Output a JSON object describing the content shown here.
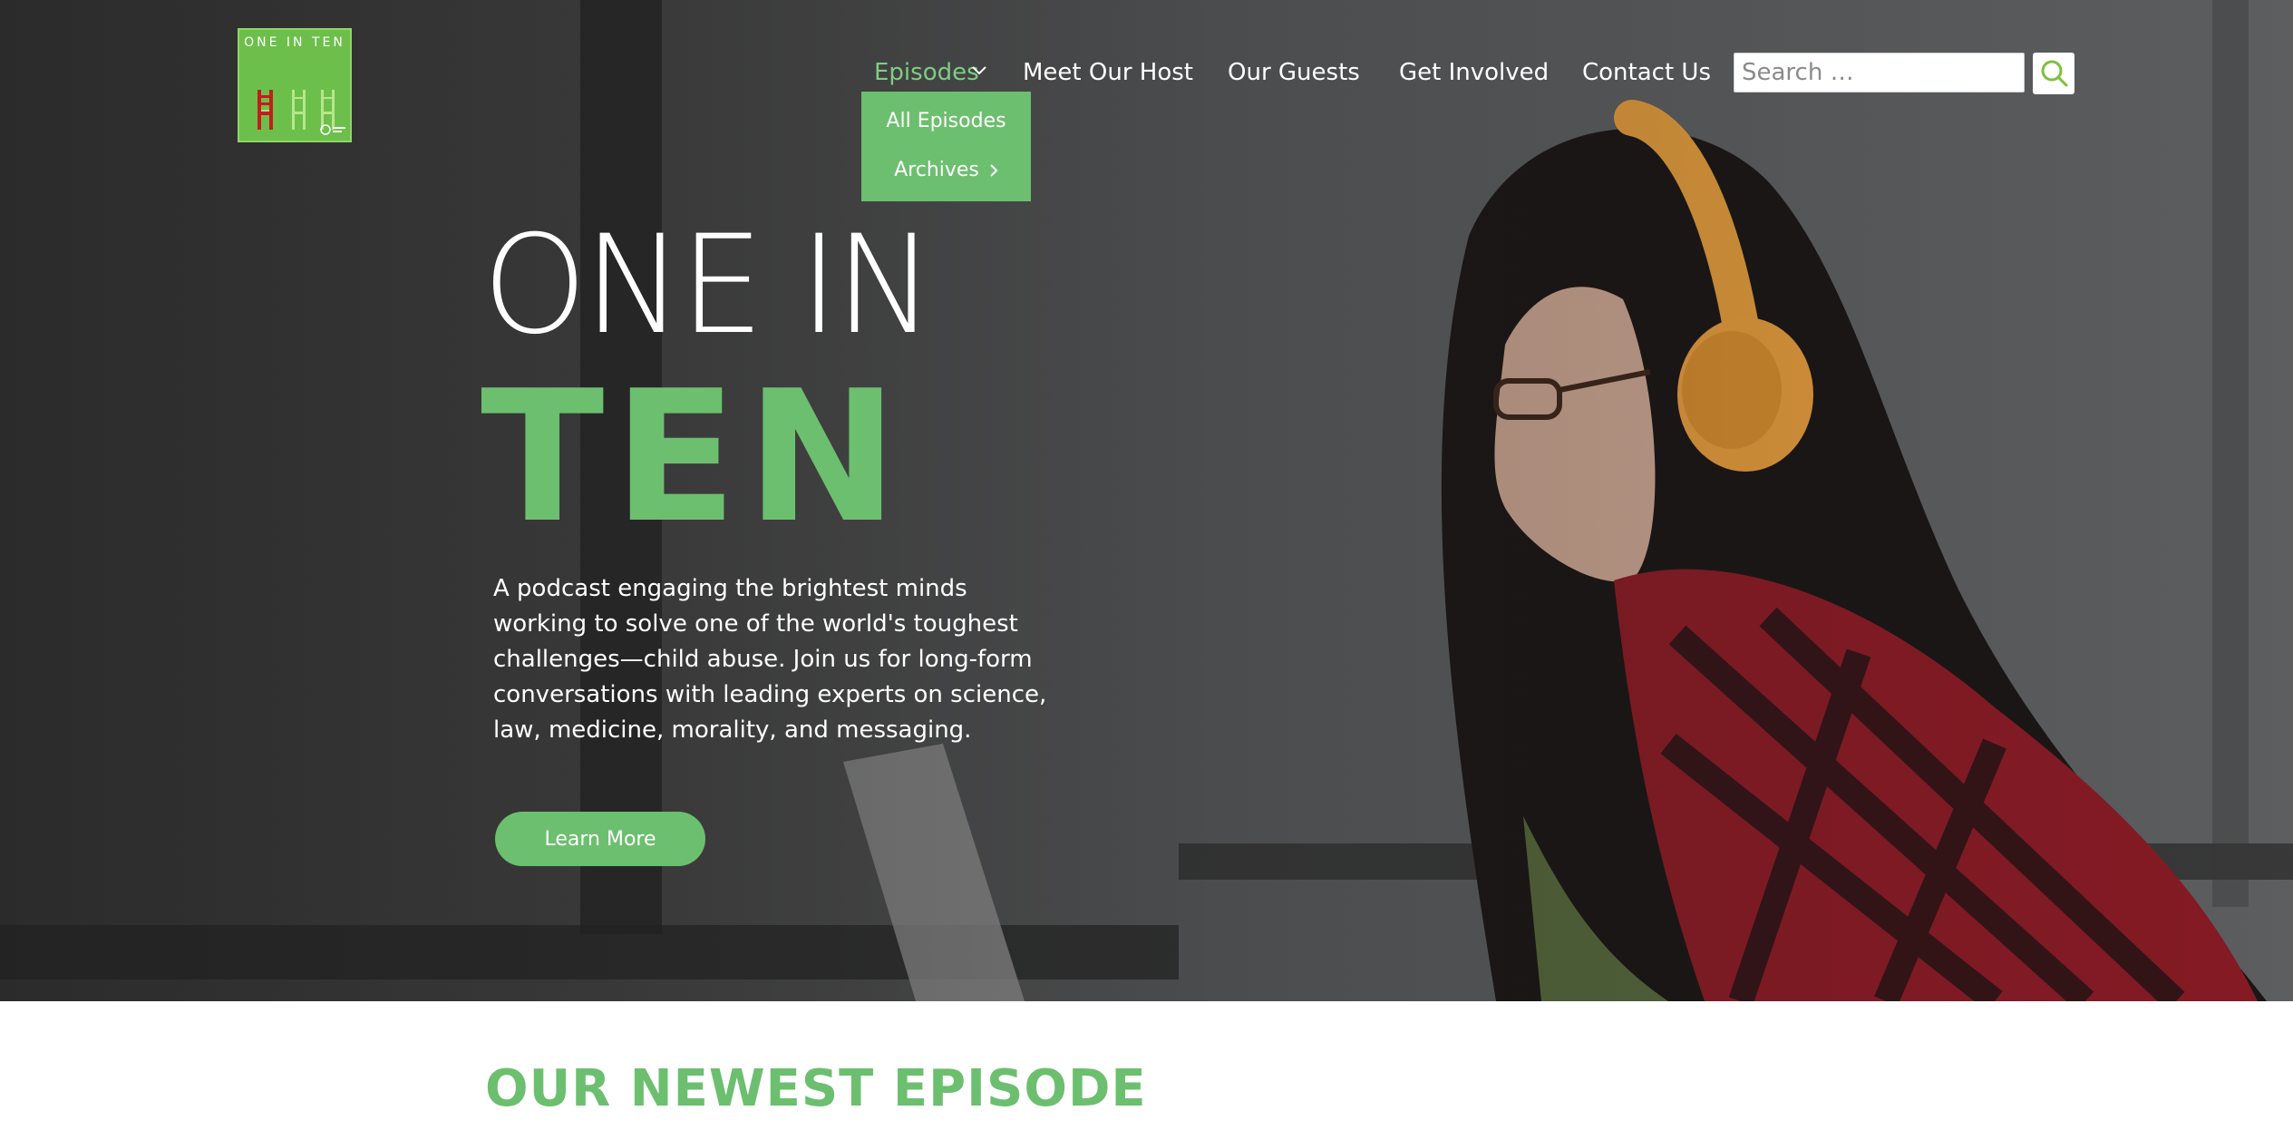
{
  "logo": {
    "text": "ONE IN TEN"
  },
  "nav": {
    "items": [
      {
        "label": "Episodes",
        "active": true
      },
      {
        "label": "Meet Our Host"
      },
      {
        "label": "Our Guests"
      },
      {
        "label": "Get Involved"
      },
      {
        "label": "Contact Us"
      }
    ],
    "dropdown": [
      {
        "label": "All Episodes"
      },
      {
        "label": "Archives"
      }
    ]
  },
  "search": {
    "placeholder": "Search …",
    "icon": "search-icon"
  },
  "hero": {
    "title_line1": "ONE IN",
    "title_line2": "TEN",
    "tagline": "A podcast engaging the brightest minds working to solve one of the world's toughest challenges—child abuse. Join us for long-form conversations with leading experts on science, law, medicine, morality, and messaging.",
    "button": "Learn More"
  },
  "section": {
    "title": "OUR NEWEST EPISODE"
  },
  "colors": {
    "accent": "#6cbf6e",
    "white": "#ffffff"
  }
}
